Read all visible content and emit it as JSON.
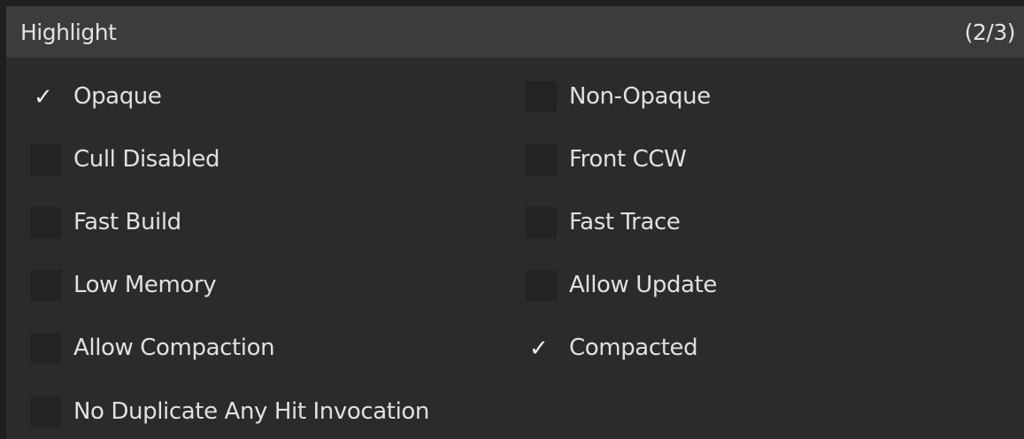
{
  "header": {
    "title": "Highlight",
    "count": "(2/3)"
  },
  "options": {
    "opaque": {
      "label": "Opaque",
      "checked": true
    },
    "non_opaque": {
      "label": "Non-Opaque",
      "checked": false
    },
    "cull_disabled": {
      "label": "Cull Disabled",
      "checked": false
    },
    "front_ccw": {
      "label": "Front CCW",
      "checked": false
    },
    "fast_build": {
      "label": "Fast Build",
      "checked": false
    },
    "fast_trace": {
      "label": "Fast Trace",
      "checked": false
    },
    "low_memory": {
      "label": "Low Memory",
      "checked": false
    },
    "allow_update": {
      "label": "Allow Update",
      "checked": false
    },
    "allow_compaction": {
      "label": "Allow Compaction",
      "checked": false
    },
    "compacted": {
      "label": "Compacted",
      "checked": true
    },
    "no_duplicate_any_hit_invocation": {
      "label": "No Duplicate Any Hit Invocation",
      "checked": false
    }
  },
  "icons": {
    "checkmark": "check-icon"
  },
  "colors": {
    "panel_bg": "#2b2b2b",
    "header_bg": "#3c3c3c",
    "checkbox_bg": "#232323",
    "text": "#e0e0e0"
  }
}
